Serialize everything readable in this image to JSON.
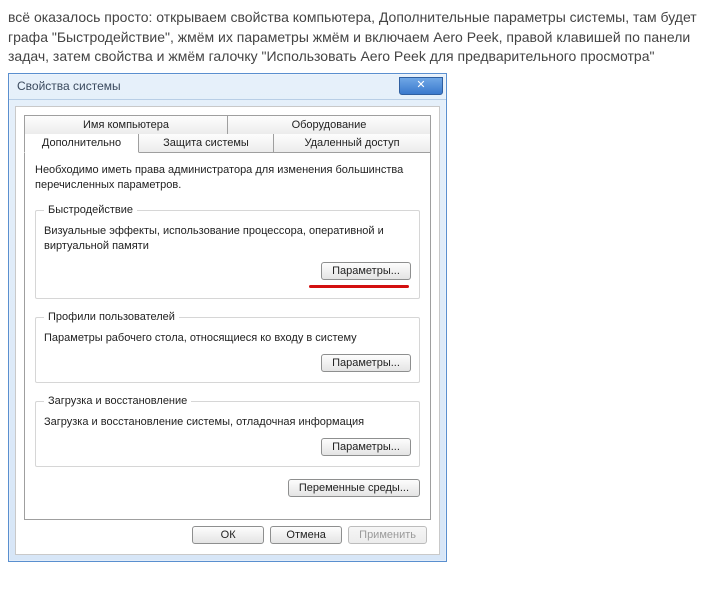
{
  "intro_text": "всё оказалось просто: открываем свойства компьютера, Дополнительные параметры системы, там будет графа \"Быстродействие\", жмём их параметры жмём и включаем Aero Peek, правой клавишей по панели задач, затем свойства и жмём галочку \"Использовать Aero Peek для предварительного просмотра\"",
  "window": {
    "title": "Свойства системы",
    "close_glyph": "✕",
    "tabs_row1": [
      "Имя компьютера",
      "Оборудование"
    ],
    "tabs_row2": [
      "Дополнительно",
      "Защита системы",
      "Удаленный доступ"
    ],
    "panel": {
      "intro": "Необходимо иметь права администратора для изменения большинства перечисленных параметров.",
      "groups": [
        {
          "legend": "Быстродействие",
          "desc": "Визуальные эффекты, использование процессора, оперативной и виртуальной памяти",
          "button": "Параметры...",
          "highlight": true
        },
        {
          "legend": "Профили пользователей",
          "desc": "Параметры рабочего стола, относящиеся ко входу в систему",
          "button": "Параметры...",
          "highlight": false
        },
        {
          "legend": "Загрузка и восстановление",
          "desc": "Загрузка и восстановление системы, отладочная информация",
          "button": "Параметры...",
          "highlight": false
        }
      ],
      "env_button": "Переменные среды..."
    },
    "buttons": {
      "ok": "ОК",
      "cancel": "Отмена",
      "apply": "Применить"
    }
  }
}
